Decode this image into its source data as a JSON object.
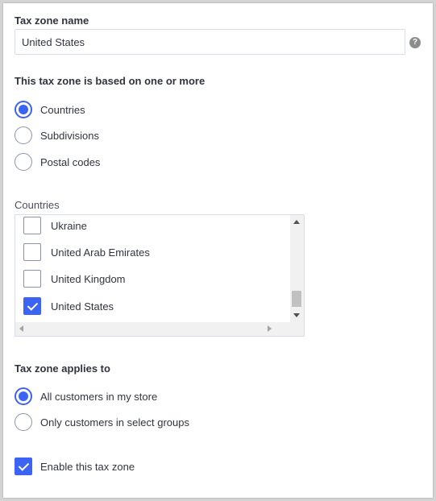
{
  "tax_zone_name": {
    "label": "Tax zone name",
    "value": "United States",
    "help_icon": "question-circle-icon",
    "help_glyph": "?"
  },
  "based_on": {
    "heading": "This tax zone is based on one or more",
    "options": [
      {
        "label": "Countries",
        "selected": true
      },
      {
        "label": "Subdivisions",
        "selected": false
      },
      {
        "label": "Postal codes",
        "selected": false
      }
    ]
  },
  "countries": {
    "label": "Countries",
    "items": [
      {
        "label": "Ukraine",
        "checked": false
      },
      {
        "label": "United Arab Emirates",
        "checked": false
      },
      {
        "label": "United Kingdom",
        "checked": false
      },
      {
        "label": "United States",
        "checked": true
      }
    ]
  },
  "applies_to": {
    "heading": "Tax zone applies to",
    "options": [
      {
        "label": "All customers in my store",
        "selected": true
      },
      {
        "label": "Only customers in select groups",
        "selected": false
      }
    ]
  },
  "enable": {
    "label": "Enable this tax zone",
    "checked": true
  },
  "colors": {
    "accent": "#3c64f4",
    "text": "#313440",
    "border": "#d9dce9"
  }
}
